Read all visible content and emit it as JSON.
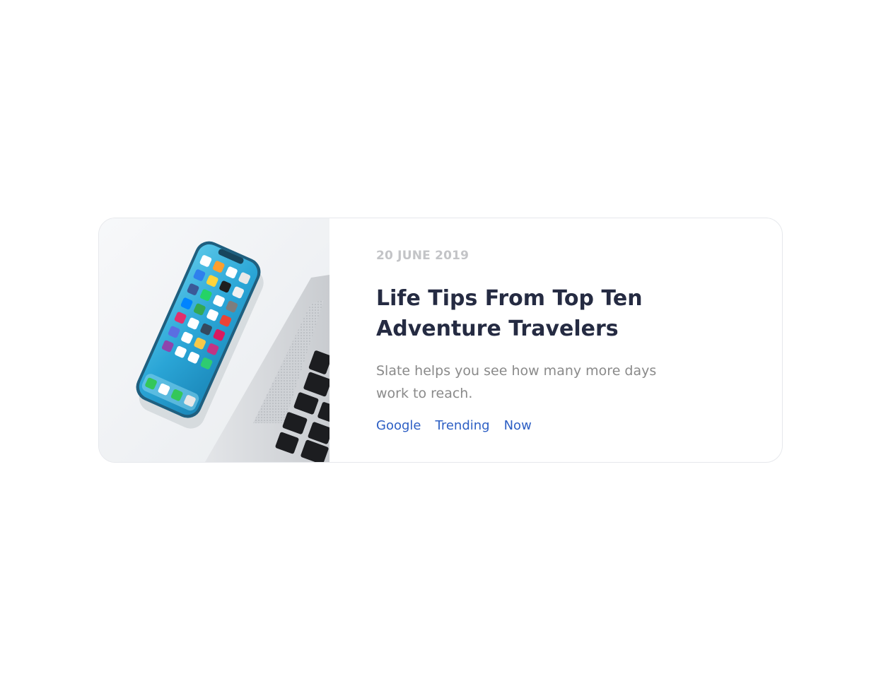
{
  "card": {
    "image_alt": "Smartphone on white desk next to laptop",
    "date": "20 JUNE 2019",
    "title": "Life Tips From Top Ten Adventure Travelers",
    "description": "Slate helps you see how many more days work to reach.",
    "tags": [
      "Google",
      "Trending",
      "Now"
    ]
  },
  "colors": {
    "title": "#252b42",
    "date": "#c3c4c7",
    "description": "#8a8a8a",
    "tag": "#2d5fc4",
    "border": "#e6e8ec"
  }
}
